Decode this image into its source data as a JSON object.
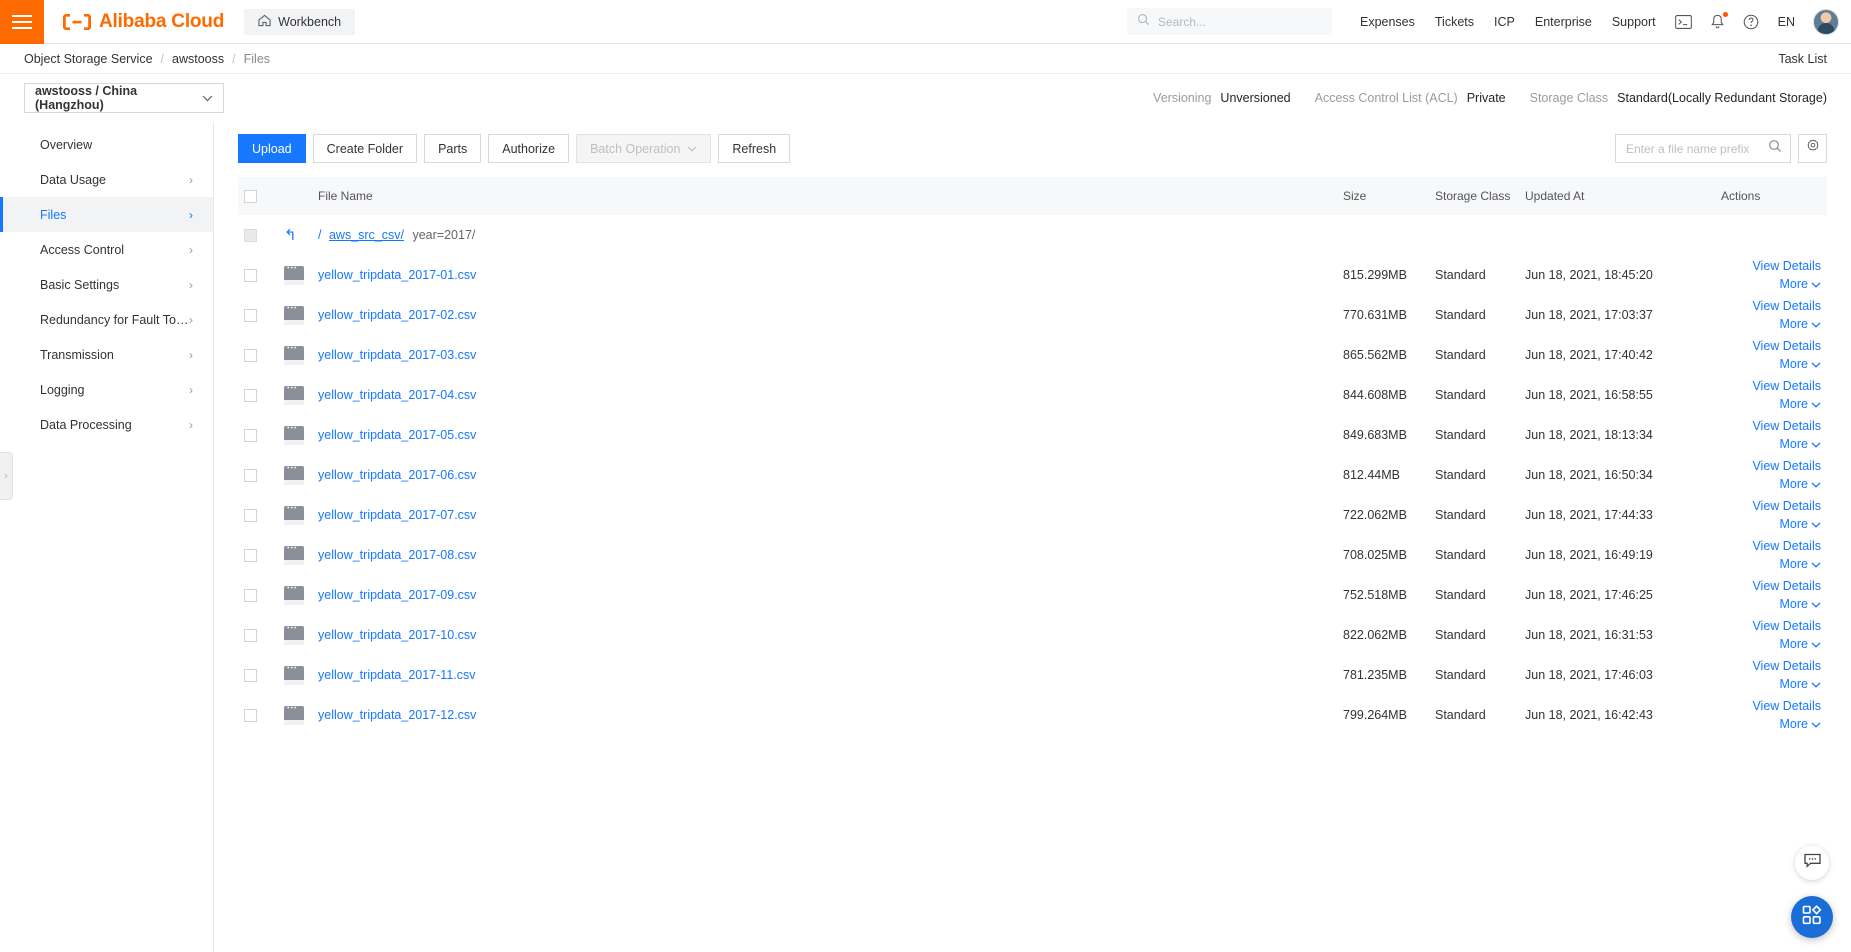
{
  "header": {
    "brand": "Alibaba Cloud",
    "workbench": "Workbench",
    "search_placeholder": "Search...",
    "nav": [
      "Expenses",
      "Tickets",
      "ICP",
      "Enterprise",
      "Support"
    ],
    "lang": "EN"
  },
  "breadcrumb": {
    "items": [
      "Object Storage Service",
      "awstooss",
      "Files"
    ],
    "separator": "/",
    "task_list": "Task List"
  },
  "subheader": {
    "bucket": "awstooss / China (Hangzhou)",
    "meta": [
      {
        "key": "Versioning",
        "value": "Unversioned"
      },
      {
        "key": "Access Control List (ACL)",
        "value": "Private"
      },
      {
        "key": "Storage Class",
        "value": "Standard(Locally Redundant Storage)"
      }
    ]
  },
  "sidebar": {
    "items": [
      {
        "label": "Overview",
        "expandable": false,
        "active": false
      },
      {
        "label": "Data Usage",
        "expandable": true,
        "active": false
      },
      {
        "label": "Files",
        "expandable": true,
        "active": true
      },
      {
        "label": "Access Control",
        "expandable": true,
        "active": false
      },
      {
        "label": "Basic Settings",
        "expandable": true,
        "active": false
      },
      {
        "label": "Redundancy for Fault Tolerance",
        "expandable": true,
        "active": false
      },
      {
        "label": "Transmission",
        "expandable": true,
        "active": false
      },
      {
        "label": "Logging",
        "expandable": true,
        "active": false
      },
      {
        "label": "Data Processing",
        "expandable": true,
        "active": false
      }
    ]
  },
  "toolbar": {
    "upload": "Upload",
    "create_folder": "Create Folder",
    "parts": "Parts",
    "authorize": "Authorize",
    "batch_operation": "Batch Operation",
    "refresh": "Refresh",
    "search_placeholder": "Enter a file name prefix",
    "search_value": ""
  },
  "table": {
    "columns": {
      "file_name": "File Name",
      "size": "Size",
      "storage_class": "Storage Class",
      "updated_at": "Updated At",
      "actions": "Actions"
    },
    "path": {
      "root": "/",
      "parent": "aws_src_csv/",
      "current": "year=2017/"
    },
    "actions": {
      "view_details": "View Details",
      "more": "More"
    },
    "rows": [
      {
        "name": "yellow_tripdata_2017-01.csv",
        "size": "815.299MB",
        "storage_class": "Standard",
        "updated_at": "Jun 18, 2021, 18:45:20"
      },
      {
        "name": "yellow_tripdata_2017-02.csv",
        "size": "770.631MB",
        "storage_class": "Standard",
        "updated_at": "Jun 18, 2021, 17:03:37"
      },
      {
        "name": "yellow_tripdata_2017-03.csv",
        "size": "865.562MB",
        "storage_class": "Standard",
        "updated_at": "Jun 18, 2021, 17:40:42"
      },
      {
        "name": "yellow_tripdata_2017-04.csv",
        "size": "844.608MB",
        "storage_class": "Standard",
        "updated_at": "Jun 18, 2021, 16:58:55"
      },
      {
        "name": "yellow_tripdata_2017-05.csv",
        "size": "849.683MB",
        "storage_class": "Standard",
        "updated_at": "Jun 18, 2021, 18:13:34"
      },
      {
        "name": "yellow_tripdata_2017-06.csv",
        "size": "812.44MB",
        "storage_class": "Standard",
        "updated_at": "Jun 18, 2021, 16:50:34"
      },
      {
        "name": "yellow_tripdata_2017-07.csv",
        "size": "722.062MB",
        "storage_class": "Standard",
        "updated_at": "Jun 18, 2021, 17:44:33"
      },
      {
        "name": "yellow_tripdata_2017-08.csv",
        "size": "708.025MB",
        "storage_class": "Standard",
        "updated_at": "Jun 18, 2021, 16:49:19"
      },
      {
        "name": "yellow_tripdata_2017-09.csv",
        "size": "752.518MB",
        "storage_class": "Standard",
        "updated_at": "Jun 18, 2021, 17:46:25"
      },
      {
        "name": "yellow_tripdata_2017-10.csv",
        "size": "822.062MB",
        "storage_class": "Standard",
        "updated_at": "Jun 18, 2021, 16:31:53"
      },
      {
        "name": "yellow_tripdata_2017-11.csv",
        "size": "781.235MB",
        "storage_class": "Standard",
        "updated_at": "Jun 18, 2021, 17:46:03"
      },
      {
        "name": "yellow_tripdata_2017-12.csv",
        "size": "799.264MB",
        "storage_class": "Standard",
        "updated_at": "Jun 18, 2021, 16:42:43"
      }
    ]
  },
  "colors": {
    "brand_orange": "#ff6a00",
    "accent_blue": "#1677ff",
    "header_bg": "#f7f8fa",
    "float_blue": "#1b6ed6"
  }
}
